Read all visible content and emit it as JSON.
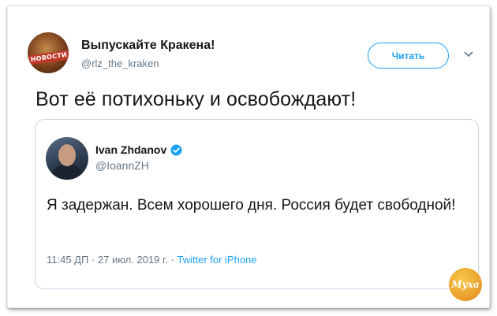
{
  "tweet": {
    "author_name": "Выпускайте Кракена!",
    "author_handle": "@rlz_the_kraken",
    "avatar_banner_text": "НОВОСТИ",
    "follow_label": "Читать",
    "text": "Вот её потихоньку и освобождают!"
  },
  "quoted_tweet": {
    "author_name": "Ivan Zhdanov",
    "author_handle": "@IoannZH",
    "verified": true,
    "text": "Я задержан. Всем хорошего дня. Россия будет свободной!",
    "timestamp": "11:45 ДП · 27 июл. 2019 г.",
    "separator": " · ",
    "source": "Twitter for iPhone"
  },
  "watermark": {
    "text": "Муха"
  },
  "colors": {
    "accent": "#1da1f2",
    "text_primary": "#14171a",
    "text_secondary": "#657786",
    "border": "#ccd6dd"
  },
  "icons": {
    "verified": "verified-badge-icon",
    "menu": "chevron-down-icon"
  }
}
